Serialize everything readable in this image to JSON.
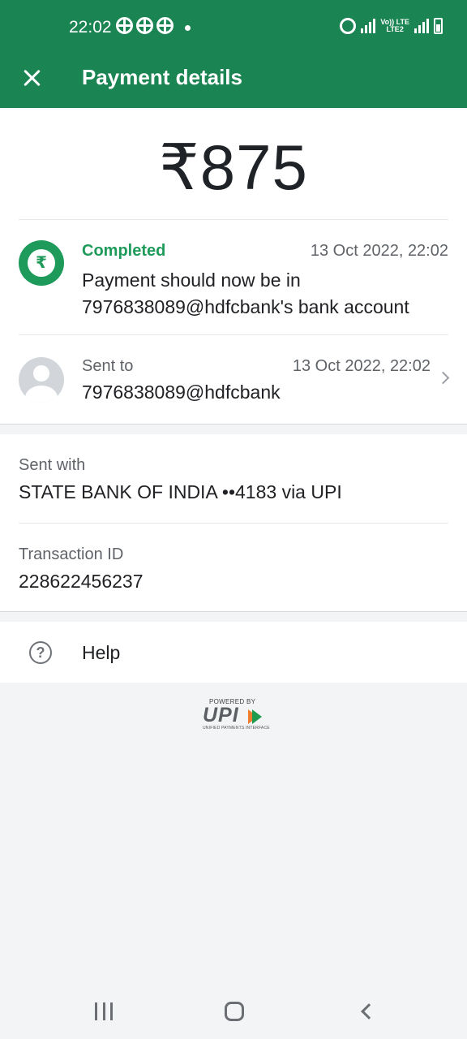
{
  "status_bar": {
    "time": "22:02",
    "network_label_1": "Vo)) LTE",
    "network_label_2": "LTE2"
  },
  "app_bar": {
    "title": "Payment details"
  },
  "payment": {
    "amount": "₹875",
    "status": {
      "label": "Completed",
      "date": "13 Oct 2022, 22:02",
      "message": "Payment should now be in 7976838089@hdfcbank's bank account",
      "icon_symbol": "₹",
      "color": "#1e9a5a"
    },
    "sent_to": {
      "label": "Sent to",
      "date": "13 Oct 2022, 22:02",
      "value": "7976838089@hdfcbank"
    }
  },
  "details": {
    "sent_with_label": "Sent with",
    "sent_with_value": "STATE BANK OF INDIA ••4183 via UPI",
    "transaction_label": "Transaction ID",
    "transaction_value": "228622456237"
  },
  "help": {
    "label": "Help",
    "icon_symbol": "?"
  },
  "footer": {
    "powered_by": "POWERED BY",
    "brand": "UPI",
    "brand_sub": "UNIFIED PAYMENTS INTERFACE"
  },
  "theme": {
    "primary": "#1b8453",
    "success": "#1e9a5a"
  }
}
